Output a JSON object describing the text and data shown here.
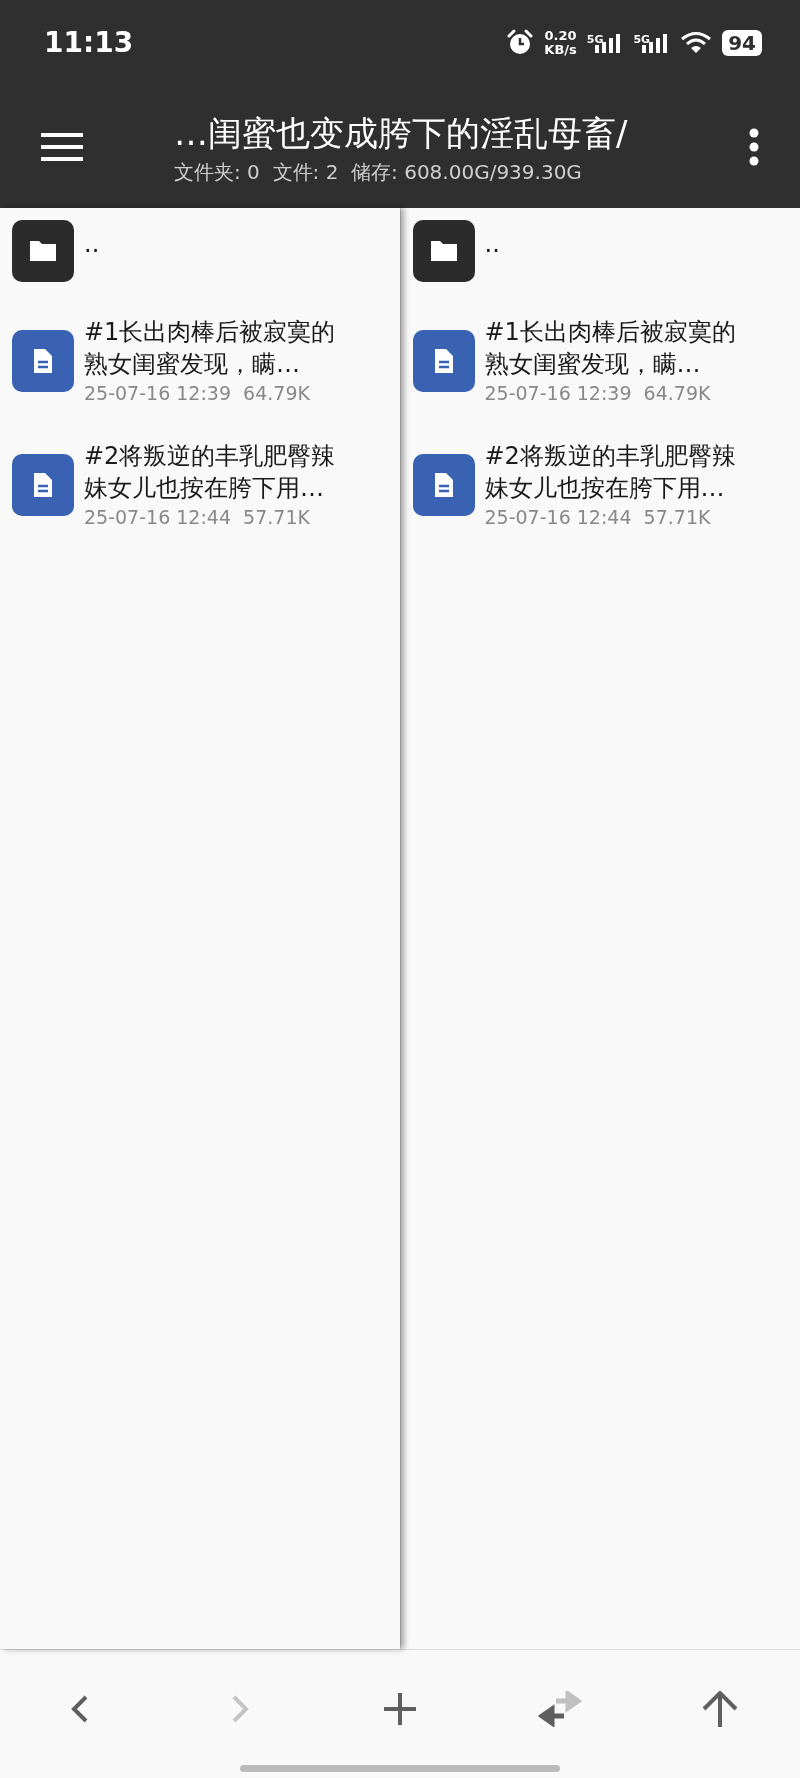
{
  "status_bar": {
    "time": "11:13",
    "speed_value": "0.20",
    "speed_unit": "KB/s",
    "sim_1": "5G",
    "sim_2": "5G",
    "battery": "94"
  },
  "header": {
    "path": "…闺蜜也变成胯下的淫乱母畜/",
    "summary": "文件夹: 0  文件: 2  储存: 608.00G/939.30G"
  },
  "panes": [
    {
      "active": true,
      "items": [
        {
          "kind": "folder",
          "name": ".."
        },
        {
          "kind": "file",
          "name": "#1长出肉棒后被寂寞的熟女闺蜜发现，瞒…",
          "meta": "25-07-16 12:39  64.79K"
        },
        {
          "kind": "file",
          "name": "#2将叛逆的丰乳肥臀辣妹女儿也按在胯下用…",
          "meta": "25-07-16 12:44  57.71K"
        }
      ]
    },
    {
      "active": false,
      "items": [
        {
          "kind": "folder",
          "name": ".."
        },
        {
          "kind": "file",
          "name": "#1长出肉棒后被寂寞的熟女闺蜜发现，瞒…",
          "meta": "25-07-16 12:39  64.79K"
        },
        {
          "kind": "file",
          "name": "#2将叛逆的丰乳肥臀辣妹女儿也按在胯下用…",
          "meta": "25-07-16 12:44  57.71K"
        }
      ]
    }
  ],
  "toolbar": [
    {
      "kind": "back",
      "disabled": false
    },
    {
      "kind": "forward",
      "disabled": true
    },
    {
      "kind": "add",
      "disabled": false
    },
    {
      "kind": "swap",
      "disabled": false
    },
    {
      "kind": "up",
      "disabled": false
    }
  ]
}
